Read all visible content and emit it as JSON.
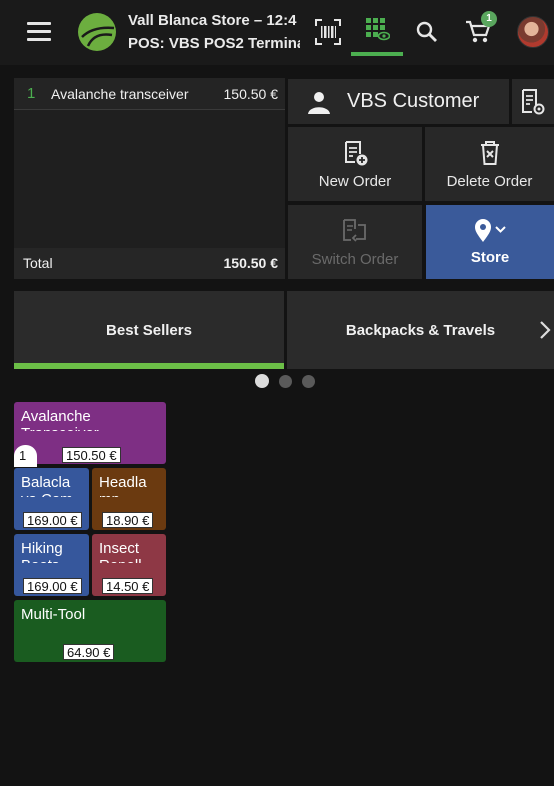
{
  "header": {
    "store_name": "Vall Blanca Store – 12:4",
    "pos_name": "POS: VBS POS2 Termina",
    "cart_count": "1",
    "icons": [
      "menu-icon",
      "logo",
      "barcode-scan-icon",
      "product-grid-icon",
      "search-icon",
      "cart-icon",
      "user-avatar"
    ]
  },
  "order": {
    "lines": [
      {
        "qty": "1",
        "name": "Avalanche transceiver",
        "price": "150.50 €"
      }
    ],
    "total_label": "Total",
    "total_value": "150.50 €"
  },
  "actions": {
    "customer": "VBS Customer",
    "new_order": "New Order",
    "delete_order": "Delete Order",
    "switch_order": "Switch Order",
    "store": "Store"
  },
  "categories": {
    "tabs": [
      "Best Sellers",
      "Backpacks & Travels"
    ],
    "active": "Best Sellers",
    "pager_pages": 3,
    "pager_active": 1
  },
  "products": [
    {
      "name": "Avalanche",
      "name2": "Transceiver",
      "price": "150.50 €",
      "qty": "1",
      "color": "#7e2f84"
    },
    {
      "name": "Balacla",
      "name2": "va Com",
      "price": "169.00 €",
      "color": "#36579c"
    },
    {
      "name": "Headla",
      "name2": "mp",
      "price": "18.90 €",
      "color": "#6b3a10"
    },
    {
      "name": "Hiking",
      "name2": "Boots",
      "price": "169.00 €",
      "color": "#36579c"
    },
    {
      "name": "Insect",
      "name2": "Repell",
      "price": "14.50 €",
      "color": "#8e3845"
    },
    {
      "name": "Multi-Tool",
      "name2": "",
      "price": "64.90 €",
      "color": "#1a5c20"
    }
  ],
  "colors": {
    "accent_green": "#4caf50",
    "tab_active_bar": "#6cbf47",
    "store_button": "#3a5a9a",
    "background": "#131313"
  }
}
